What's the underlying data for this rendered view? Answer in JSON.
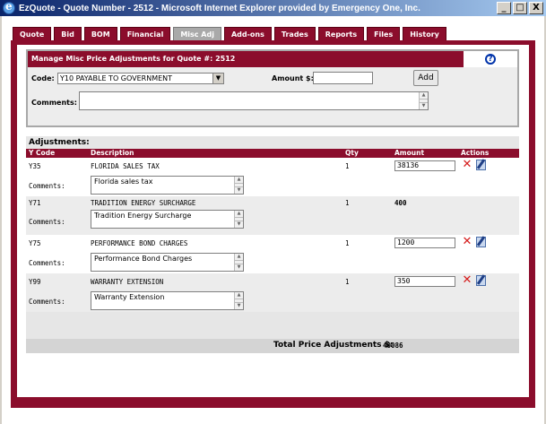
{
  "window": {
    "title": "EzQuote - Quote Number - 2512 - Microsoft Internet Explorer provided by Emergency One, Inc.",
    "minimize": "_",
    "maximize": "□",
    "close": "X"
  },
  "tabs": [
    {
      "label": "Quote",
      "active": false
    },
    {
      "label": "Bid",
      "active": false
    },
    {
      "label": "BOM",
      "active": false
    },
    {
      "label": "Financial",
      "active": false
    },
    {
      "label": "Misc Adj",
      "active": true
    },
    {
      "label": "Add-ons",
      "active": false
    },
    {
      "label": "Trades",
      "active": false
    },
    {
      "label": "Reports",
      "active": false
    },
    {
      "label": "Files",
      "active": false
    },
    {
      "label": "History",
      "active": false
    }
  ],
  "manage": {
    "title": "Manage Misc Price Adjustments for Quote #: 2512",
    "help": "?",
    "code_label": "Code:",
    "code_value": "Y10 PAYABLE TO GOVERNMENT",
    "amount_label": "Amount $:",
    "amount_value": "",
    "add_label": "Add",
    "comments_label": "Comments:",
    "comments_value": ""
  },
  "adjustments": {
    "title": "Adjustments:",
    "headers": {
      "ycode": "Y Code",
      "description": "Description",
      "qty": "Qty",
      "amount": "Amount",
      "actions": "Actions"
    },
    "comments_label": "Comments:",
    "rows": [
      {
        "code": "Y35",
        "description": "FLORIDA SALES TAX",
        "qty": "1",
        "amount": "38136",
        "editable": true,
        "comment": "Florida sales tax"
      },
      {
        "code": "Y71",
        "description": "TRADITION ENERGY SURCHARGE",
        "qty": "1",
        "amount": "400",
        "editable": false,
        "comment": "Tradition Energy Surcharge"
      },
      {
        "code": "Y75",
        "description": "PERFORMANCE BOND CHARGES",
        "qty": "1",
        "amount": "1200",
        "editable": true,
        "comment": "Performance Bond Charges"
      },
      {
        "code": "Y99",
        "description": "WARRANTY EXTENSION",
        "qty": "1",
        "amount": "350",
        "editable": true,
        "comment": "Warranty Extension"
      }
    ],
    "total_label": "Total Price Adjustments $:",
    "total_value": "40086"
  }
}
